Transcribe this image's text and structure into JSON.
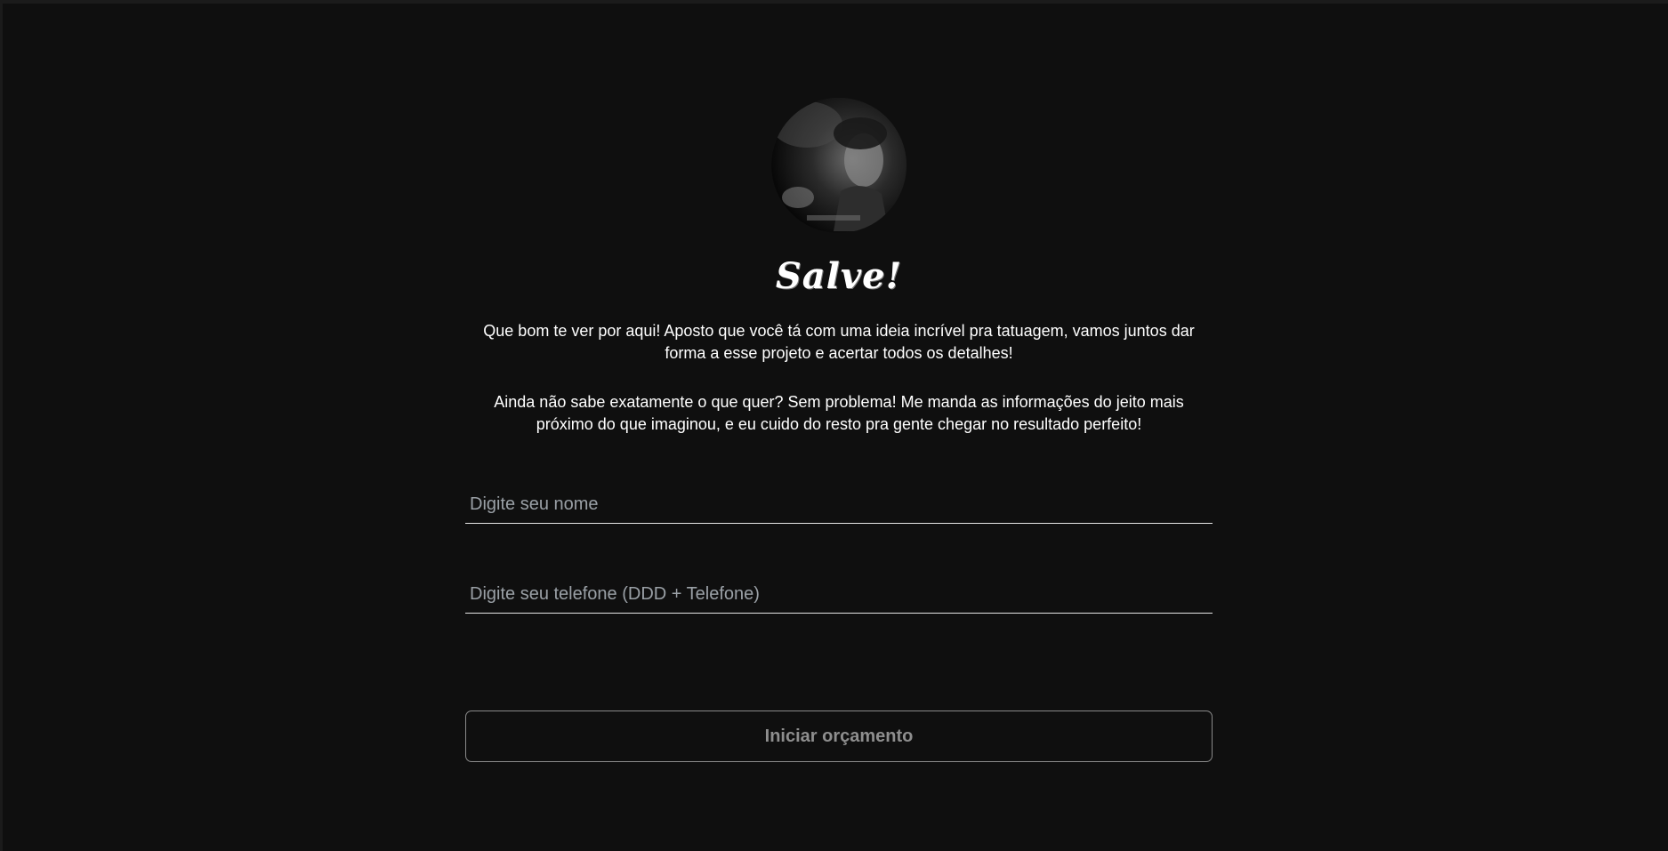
{
  "hero": {
    "avatar_icon": "portrait-photo",
    "title": "Salve!"
  },
  "intro": {
    "paragraph1": "Que bom te ver por aqui! Aposto que você tá com uma ideia incrível pra tatuagem, vamos juntos dar forma a esse projeto e acertar todos os detalhes!",
    "paragraph2": "Ainda não sabe exatamente o que quer? Sem problema! Me manda as informações do jeito mais próximo do que imaginou, e eu cuido do resto pra gente chegar no resultado perfeito!"
  },
  "form": {
    "name_value": "",
    "name_placeholder": "Digite seu nome",
    "phone_value": "",
    "phone_placeholder": "Digite seu telefone (DDD + Telefone)",
    "submit_label": "Iniciar orçamento"
  },
  "colors": {
    "background": "#0f0f0f",
    "text": "#ffffff",
    "placeholder": "#9aa0a6",
    "button_border": "#8a8a8a",
    "button_text": "#8e8e8e"
  }
}
